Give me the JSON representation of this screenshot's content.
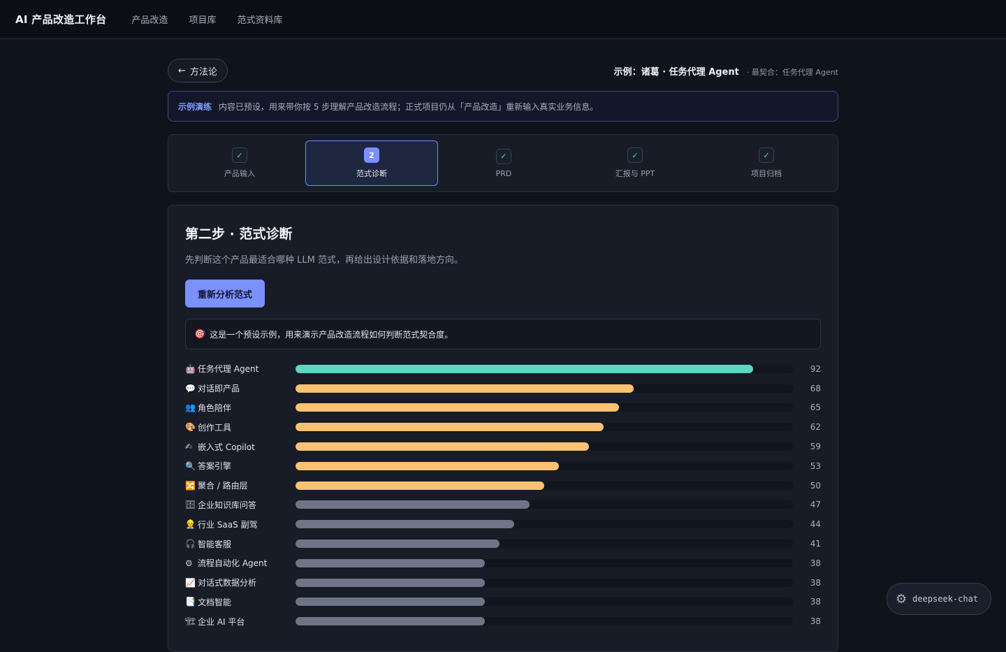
{
  "nav": {
    "brand": "AI 产品改造工作台",
    "links": [
      "产品改造",
      "项目库",
      "范式资料库"
    ]
  },
  "header": {
    "back_label": "方法论",
    "example_title": "示例：诸葛 · 任务代理 Agent",
    "example_sub": "· 最契合：任务代理 Agent"
  },
  "banner": {
    "tag": "示例演练",
    "text": "内容已预设，用来带你按 5 步理解产品改造流程；正式项目仍从「产品改造」重新输入真实业务信息。"
  },
  "steps": [
    {
      "badge": "✓",
      "label": "产品输入",
      "active": false
    },
    {
      "badge": "2",
      "label": "范式诊断",
      "active": true
    },
    {
      "badge": "✓",
      "label": "PRD",
      "active": false
    },
    {
      "badge": "✓",
      "label": "汇报与 PPT",
      "active": false
    },
    {
      "badge": "✓",
      "label": "项目归档",
      "active": false
    }
  ],
  "panel": {
    "title": "第二步 · 范式诊断",
    "desc": "先判断这个产品最适合哪种 LLM 范式，再给出设计依据和落地方向。",
    "button": "重新分析范式",
    "note": "这是一个预设示例，用来演示产品改造流程如何判断范式契合度。"
  },
  "colors": {
    "top": "#5fd6c3",
    "mid": "#fcc273",
    "low": "#6d7586"
  },
  "chart_data": {
    "type": "bar",
    "categories": [
      "任务代理 Agent",
      "对话即产品",
      "角色陪伴",
      "创作工具",
      "嵌入式 Copilot",
      "答案引擎",
      "聚合 / 路由层",
      "企业知识库问答",
      "行业 SaaS 副驾",
      "智能客服",
      "流程自动化 Agent",
      "对话式数据分析",
      "文档智能",
      "企业 AI 平台"
    ],
    "icons": [
      "🤖",
      "💬",
      "👥",
      "🎨",
      "✍",
      "🔍",
      "🔀",
      "🗄",
      "👷",
      "🎧",
      "⚙",
      "📈",
      "📑",
      "🏗"
    ],
    "values": [
      92,
      68,
      65,
      62,
      59,
      53,
      50,
      47,
      44,
      41,
      38,
      38,
      38,
      38
    ],
    "xlim": [
      0,
      100
    ]
  },
  "model": {
    "name": "deepseek-chat"
  }
}
